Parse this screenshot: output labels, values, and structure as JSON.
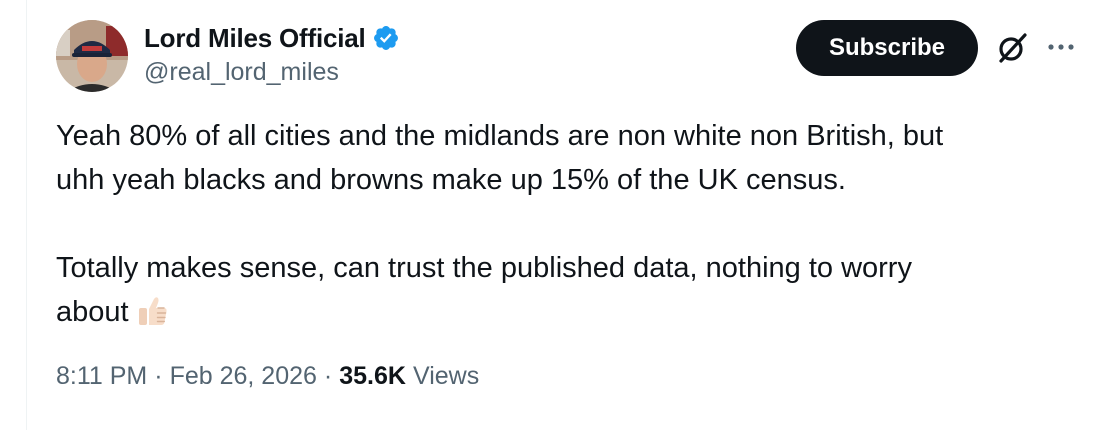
{
  "author": {
    "display_name": "Lord Miles Official",
    "handle": "@real_lord_miles",
    "verified": true,
    "verified_badge_color": "#1d9bf0",
    "avatar_icon": "profile-photo"
  },
  "actions": {
    "subscribe_label": "Subscribe",
    "subscribe_bg": "#0f1419",
    "grok_icon": "grok-icon",
    "more_icon": "more-dots-icon"
  },
  "tweet": {
    "paragraphs": [
      [
        "Yeah 80% of all cities and the midlands are non white non British, but",
        "uhh yeah blacks and browns make up 15% of the UK census."
      ],
      [
        "Totally makes sense, can trust the published data, nothing to worry",
        "about"
      ]
    ],
    "emoji": "thumbs-up-light-skin-tone"
  },
  "meta": {
    "time": "8:11 PM",
    "separator": "·",
    "date": "Feb 26, 2026",
    "views_count": "35.6K",
    "views_label": "Views"
  },
  "colors": {
    "text_primary": "#0f1419",
    "text_secondary": "#536471",
    "accent": "#1d9bf0"
  }
}
